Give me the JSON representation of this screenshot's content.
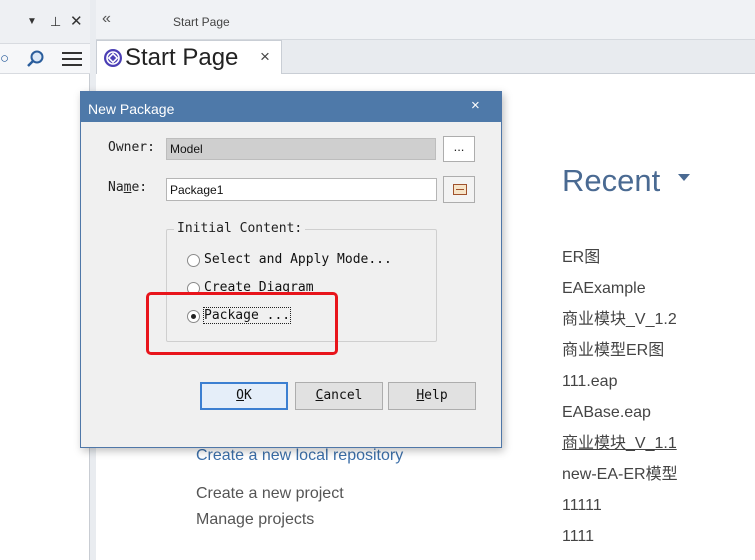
{
  "left_panel": {
    "icons": [
      "dropdown-triangle-icon",
      "pin-icon",
      "close-icon",
      "search-icon",
      "find-icon",
      "hamburger-menu-icon"
    ]
  },
  "workspace": {
    "title": "Start Page",
    "tab": {
      "label": "Start Page",
      "close": "×"
    }
  },
  "start_page": {
    "recent_heading": "Recent",
    "recent_items": [
      "ER图",
      "EAExample",
      "商业模块_V_1.2",
      "商业模型ER图",
      "111.eap",
      "EABase.eap",
      "商业模块_V_1.1",
      "new-EA-ER模型",
      "11111",
      "1111"
    ],
    "links": {
      "local_repository": "Create a new local repository",
      "create_project": "Create a new project",
      "manage_projects": "Manage projects"
    }
  },
  "dialog": {
    "title": "New Package",
    "close": "×",
    "owner": {
      "prefix": "Owner",
      "colon": ":",
      "value": "Model",
      "browse_label": "..."
    },
    "name": {
      "prefix": "Na",
      "underline": "m",
      "suffix": "e:",
      "value": "Package1"
    },
    "initial_content": {
      "legend": "Initial Content:",
      "options": [
        {
          "label": "Select and Apply Mode...",
          "checked": false
        },
        {
          "label": "Create Diagram",
          "checked": false
        },
        {
          "label": "Package ...",
          "checked": true
        }
      ]
    },
    "buttons": {
      "ok": {
        "underline": "O",
        "rest": "K"
      },
      "cancel": {
        "underline": "C",
        "rest": "ancel"
      },
      "help": {
        "underline": "H",
        "rest": "elp"
      }
    }
  },
  "annotation": {
    "color": "#e8141b"
  },
  "colors": {
    "dialog_titlebar": "#4e79a9",
    "recent_heading": "#4a6a92",
    "link": "#3b6ea8"
  }
}
